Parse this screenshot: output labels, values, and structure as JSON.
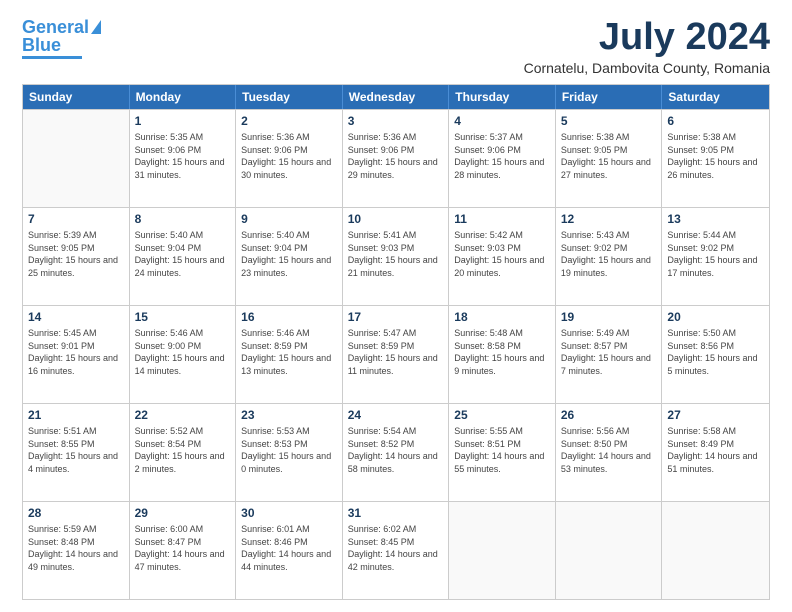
{
  "header": {
    "logo_line1": "General",
    "logo_line2": "Blue",
    "month": "July 2024",
    "location": "Cornatelu, Dambovita County, Romania"
  },
  "weekdays": [
    "Sunday",
    "Monday",
    "Tuesday",
    "Wednesday",
    "Thursday",
    "Friday",
    "Saturday"
  ],
  "weeks": [
    [
      {
        "day": "",
        "empty": true
      },
      {
        "day": "1",
        "sunrise": "Sunrise: 5:35 AM",
        "sunset": "Sunset: 9:06 PM",
        "daylight": "Daylight: 15 hours and 31 minutes."
      },
      {
        "day": "2",
        "sunrise": "Sunrise: 5:36 AM",
        "sunset": "Sunset: 9:06 PM",
        "daylight": "Daylight: 15 hours and 30 minutes."
      },
      {
        "day": "3",
        "sunrise": "Sunrise: 5:36 AM",
        "sunset": "Sunset: 9:06 PM",
        "daylight": "Daylight: 15 hours and 29 minutes."
      },
      {
        "day": "4",
        "sunrise": "Sunrise: 5:37 AM",
        "sunset": "Sunset: 9:06 PM",
        "daylight": "Daylight: 15 hours and 28 minutes."
      },
      {
        "day": "5",
        "sunrise": "Sunrise: 5:38 AM",
        "sunset": "Sunset: 9:05 PM",
        "daylight": "Daylight: 15 hours and 27 minutes."
      },
      {
        "day": "6",
        "sunrise": "Sunrise: 5:38 AM",
        "sunset": "Sunset: 9:05 PM",
        "daylight": "Daylight: 15 hours and 26 minutes."
      }
    ],
    [
      {
        "day": "7",
        "sunrise": "Sunrise: 5:39 AM",
        "sunset": "Sunset: 9:05 PM",
        "daylight": "Daylight: 15 hours and 25 minutes."
      },
      {
        "day": "8",
        "sunrise": "Sunrise: 5:40 AM",
        "sunset": "Sunset: 9:04 PM",
        "daylight": "Daylight: 15 hours and 24 minutes."
      },
      {
        "day": "9",
        "sunrise": "Sunrise: 5:40 AM",
        "sunset": "Sunset: 9:04 PM",
        "daylight": "Daylight: 15 hours and 23 minutes."
      },
      {
        "day": "10",
        "sunrise": "Sunrise: 5:41 AM",
        "sunset": "Sunset: 9:03 PM",
        "daylight": "Daylight: 15 hours and 21 minutes."
      },
      {
        "day": "11",
        "sunrise": "Sunrise: 5:42 AM",
        "sunset": "Sunset: 9:03 PM",
        "daylight": "Daylight: 15 hours and 20 minutes."
      },
      {
        "day": "12",
        "sunrise": "Sunrise: 5:43 AM",
        "sunset": "Sunset: 9:02 PM",
        "daylight": "Daylight: 15 hours and 19 minutes."
      },
      {
        "day": "13",
        "sunrise": "Sunrise: 5:44 AM",
        "sunset": "Sunset: 9:02 PM",
        "daylight": "Daylight: 15 hours and 17 minutes."
      }
    ],
    [
      {
        "day": "14",
        "sunrise": "Sunrise: 5:45 AM",
        "sunset": "Sunset: 9:01 PM",
        "daylight": "Daylight: 15 hours and 16 minutes."
      },
      {
        "day": "15",
        "sunrise": "Sunrise: 5:46 AM",
        "sunset": "Sunset: 9:00 PM",
        "daylight": "Daylight: 15 hours and 14 minutes."
      },
      {
        "day": "16",
        "sunrise": "Sunrise: 5:46 AM",
        "sunset": "Sunset: 8:59 PM",
        "daylight": "Daylight: 15 hours and 13 minutes."
      },
      {
        "day": "17",
        "sunrise": "Sunrise: 5:47 AM",
        "sunset": "Sunset: 8:59 PM",
        "daylight": "Daylight: 15 hours and 11 minutes."
      },
      {
        "day": "18",
        "sunrise": "Sunrise: 5:48 AM",
        "sunset": "Sunset: 8:58 PM",
        "daylight": "Daylight: 15 hours and 9 minutes."
      },
      {
        "day": "19",
        "sunrise": "Sunrise: 5:49 AM",
        "sunset": "Sunset: 8:57 PM",
        "daylight": "Daylight: 15 hours and 7 minutes."
      },
      {
        "day": "20",
        "sunrise": "Sunrise: 5:50 AM",
        "sunset": "Sunset: 8:56 PM",
        "daylight": "Daylight: 15 hours and 5 minutes."
      }
    ],
    [
      {
        "day": "21",
        "sunrise": "Sunrise: 5:51 AM",
        "sunset": "Sunset: 8:55 PM",
        "daylight": "Daylight: 15 hours and 4 minutes."
      },
      {
        "day": "22",
        "sunrise": "Sunrise: 5:52 AM",
        "sunset": "Sunset: 8:54 PM",
        "daylight": "Daylight: 15 hours and 2 minutes."
      },
      {
        "day": "23",
        "sunrise": "Sunrise: 5:53 AM",
        "sunset": "Sunset: 8:53 PM",
        "daylight": "Daylight: 15 hours and 0 minutes."
      },
      {
        "day": "24",
        "sunrise": "Sunrise: 5:54 AM",
        "sunset": "Sunset: 8:52 PM",
        "daylight": "Daylight: 14 hours and 58 minutes."
      },
      {
        "day": "25",
        "sunrise": "Sunrise: 5:55 AM",
        "sunset": "Sunset: 8:51 PM",
        "daylight": "Daylight: 14 hours and 55 minutes."
      },
      {
        "day": "26",
        "sunrise": "Sunrise: 5:56 AM",
        "sunset": "Sunset: 8:50 PM",
        "daylight": "Daylight: 14 hours and 53 minutes."
      },
      {
        "day": "27",
        "sunrise": "Sunrise: 5:58 AM",
        "sunset": "Sunset: 8:49 PM",
        "daylight": "Daylight: 14 hours and 51 minutes."
      }
    ],
    [
      {
        "day": "28",
        "sunrise": "Sunrise: 5:59 AM",
        "sunset": "Sunset: 8:48 PM",
        "daylight": "Daylight: 14 hours and 49 minutes."
      },
      {
        "day": "29",
        "sunrise": "Sunrise: 6:00 AM",
        "sunset": "Sunset: 8:47 PM",
        "daylight": "Daylight: 14 hours and 47 minutes."
      },
      {
        "day": "30",
        "sunrise": "Sunrise: 6:01 AM",
        "sunset": "Sunset: 8:46 PM",
        "daylight": "Daylight: 14 hours and 44 minutes."
      },
      {
        "day": "31",
        "sunrise": "Sunrise: 6:02 AM",
        "sunset": "Sunset: 8:45 PM",
        "daylight": "Daylight: 14 hours and 42 minutes."
      },
      {
        "day": "",
        "empty": true
      },
      {
        "day": "",
        "empty": true
      },
      {
        "day": "",
        "empty": true
      }
    ]
  ]
}
